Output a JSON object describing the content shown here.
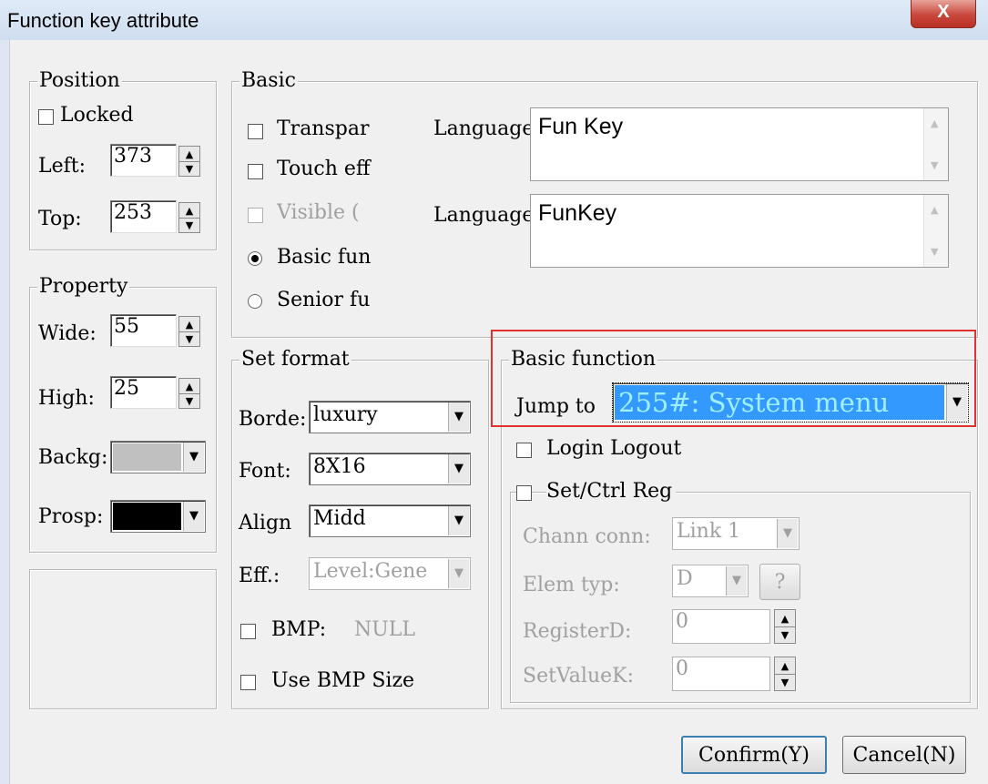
{
  "window": {
    "title": "Function key attribute",
    "close_glyph": "X"
  },
  "position": {
    "label": "Position",
    "locked_label": "Locked",
    "left_label": "Left:",
    "left_value": "373",
    "top_label": "Top:",
    "top_value": "253"
  },
  "property": {
    "label": "Property",
    "wide_label": "Wide:",
    "wide_value": "55",
    "high_label": "High:",
    "high_value": "25",
    "backg_label": "Backg:",
    "backg_color": "#c0c0c0",
    "prosp_label": "Prosp:",
    "prosp_color": "#000000"
  },
  "basic": {
    "label": "Basic",
    "transparent_label": "Transpar",
    "touch_label": "Touch eff",
    "visible_label": "Visible (",
    "basic_fun_label": "Basic fun",
    "senior_fun_label": "Senior fu",
    "language1_label": "Language",
    "language1_value": "Fun Key",
    "language2_label": "Language",
    "language2_value": "FunKey"
  },
  "set_format": {
    "label": "Set format",
    "border_label": "Borde:",
    "border_value": "luxury",
    "font_label": "Font:",
    "font_value": "8X16",
    "align_label": "Align",
    "align_value": "Midd",
    "eff_label": "Eff.:",
    "eff_value": "Level:Gene",
    "bmp_label": "BMP:",
    "bmp_value": "NULL",
    "use_bmp_size_label": "Use BMP Size"
  },
  "basic_function": {
    "label": "Basic function",
    "jump_label": "Jump to",
    "jump_value": "255#: System menu",
    "login_label": "Login Logout",
    "setctrl_label": "Set/Ctrl Reg",
    "chann_label": "Chann conn:",
    "chann_value": "Link 1",
    "elem_label": "Elem typ:",
    "elem_value": "D",
    "elem_help": "?",
    "register_label": "RegisterD:",
    "register_value": "0",
    "setvalue_label": "SetValueK:",
    "setvalue_value": "0"
  },
  "buttons": {
    "confirm": "Confirm(Y)",
    "cancel": "Cancel(N)"
  },
  "icons": {
    "spin_up": "▲",
    "spin_down": "▼",
    "combo_arrow": "▼",
    "scroll_up": "▲",
    "scroll_down": "▼"
  },
  "colors": {
    "highlight": "#e0322f",
    "selection": "#3399ff"
  }
}
